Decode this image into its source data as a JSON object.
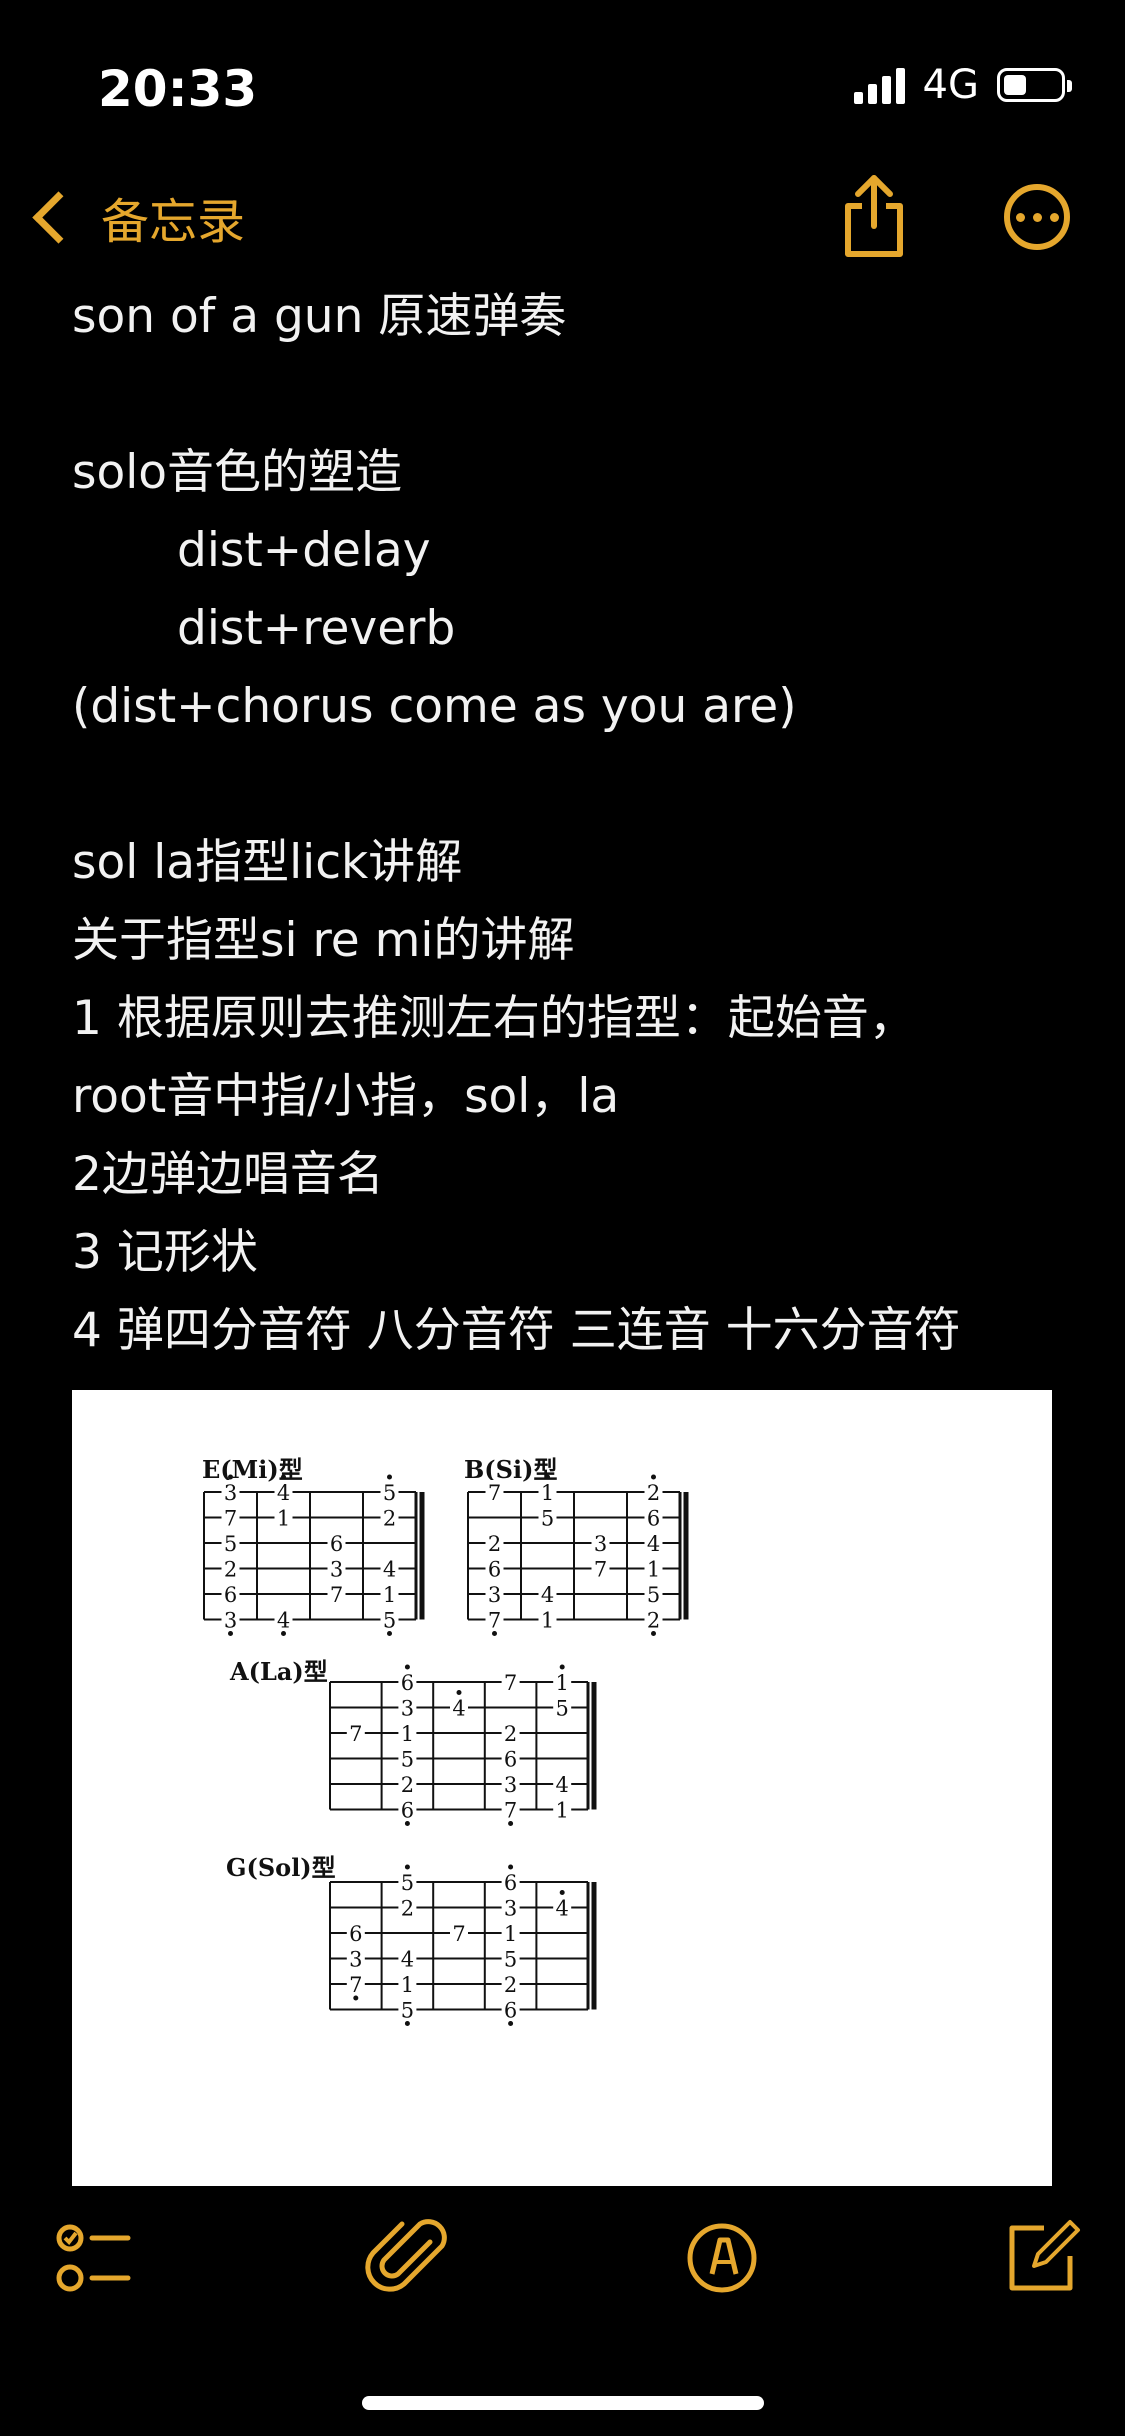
{
  "status": {
    "time": "20:33",
    "network": "4G"
  },
  "nav": {
    "back_label": "备忘录"
  },
  "note": {
    "lines": [
      "son of a gun 原速弹奏",
      "",
      "solo音色的塑造",
      "dist+delay",
      "dist+reverb",
      "(dist+chorus come as you are)",
      "",
      "sol la指型lick讲解",
      "关于指型si re mi的讲解",
      "1 根据原则去推测左右的指型：起始音，",
      "root音中指/小指，sol，la",
      "2边弹边唱音名",
      "3 记形状",
      "4 弹四分音符 八分音符 三连音 十六分音符"
    ]
  },
  "image": {
    "diagrams": [
      {
        "title": "E(Mi)型",
        "notes": [
          {
            "s": 0,
            "f": 0,
            "t": "3",
            "d": "up"
          },
          {
            "s": 1,
            "f": 0,
            "t": "7"
          },
          {
            "s": 2,
            "f": 0,
            "t": "5"
          },
          {
            "s": 3,
            "f": 0,
            "t": "2"
          },
          {
            "s": 4,
            "f": 0,
            "t": "6"
          },
          {
            "s": 5,
            "f": 0,
            "t": "3",
            "d": "down"
          },
          {
            "s": 0,
            "f": 1,
            "t": "4",
            "d": "up"
          },
          {
            "s": 1,
            "f": 1,
            "t": "1"
          },
          {
            "s": 5,
            "f": 1,
            "t": "4",
            "d": "down"
          },
          {
            "s": 2,
            "f": 2,
            "t": "6"
          },
          {
            "s": 3,
            "f": 2,
            "t": "3"
          },
          {
            "s": 4,
            "f": 2,
            "t": "7"
          },
          {
            "s": 0,
            "f": 3,
            "t": "5",
            "d": "up"
          },
          {
            "s": 1,
            "f": 3,
            "t": "2"
          },
          {
            "s": 3,
            "f": 3,
            "t": "4"
          },
          {
            "s": 4,
            "f": 3,
            "t": "1"
          },
          {
            "s": 5,
            "f": 3,
            "t": "5",
            "d": "down"
          }
        ]
      },
      {
        "title": "B(Si)型",
        "notes": [
          {
            "s": 0,
            "f": 0,
            "t": "7"
          },
          {
            "s": 2,
            "f": 0,
            "t": "2"
          },
          {
            "s": 3,
            "f": 0,
            "t": "6"
          },
          {
            "s": 4,
            "f": 0,
            "t": "3"
          },
          {
            "s": 5,
            "f": 0,
            "t": "7",
            "d": "down"
          },
          {
            "s": 0,
            "f": 1,
            "t": "1",
            "d": "up"
          },
          {
            "s": 1,
            "f": 1,
            "t": "5"
          },
          {
            "s": 4,
            "f": 1,
            "t": "4"
          },
          {
            "s": 5,
            "f": 1,
            "t": "1"
          },
          {
            "s": 2,
            "f": 2,
            "t": "3"
          },
          {
            "s": 3,
            "f": 2,
            "t": "7"
          },
          {
            "s": 0,
            "f": 3,
            "t": "2",
            "d": "up"
          },
          {
            "s": 1,
            "f": 3,
            "t": "6"
          },
          {
            "s": 2,
            "f": 3,
            "t": "4"
          },
          {
            "s": 3,
            "f": 3,
            "t": "1"
          },
          {
            "s": 4,
            "f": 3,
            "t": "5"
          },
          {
            "s": 5,
            "f": 3,
            "t": "2",
            "d": "down"
          }
        ]
      },
      {
        "title": "A(La)型",
        "notes": [
          {
            "s": 0,
            "f": 1,
            "t": "6",
            "d": "up"
          },
          {
            "s": 1,
            "f": 1,
            "t": "3"
          },
          {
            "s": 2,
            "f": 1,
            "t": "1"
          },
          {
            "s": 3,
            "f": 1,
            "t": "5"
          },
          {
            "s": 4,
            "f": 1,
            "t": "2"
          },
          {
            "s": 5,
            "f": 1,
            "t": "6",
            "d": "down"
          },
          {
            "s": 2,
            "f": 0,
            "t": "7"
          },
          {
            "s": 1,
            "f": 2,
            "t": "4",
            "d": "up"
          },
          {
            "s": 0,
            "f": 3,
            "t": "7"
          },
          {
            "s": 2,
            "f": 3,
            "t": "2"
          },
          {
            "s": 3,
            "f": 3,
            "t": "6"
          },
          {
            "s": 4,
            "f": 3,
            "t": "3"
          },
          {
            "s": 5,
            "f": 3,
            "t": "7",
            "d": "down"
          },
          {
            "s": 0,
            "f": 4,
            "t": "1",
            "d": "up"
          },
          {
            "s": 1,
            "f": 4,
            "t": "5"
          },
          {
            "s": 4,
            "f": 4,
            "t": "4"
          },
          {
            "s": 5,
            "f": 4,
            "t": "1"
          }
        ]
      },
      {
        "title": "G(Sol)型",
        "notes": [
          {
            "s": 0,
            "f": 1,
            "t": "5",
            "d": "up"
          },
          {
            "s": 1,
            "f": 1,
            "t": "2"
          },
          {
            "s": 3,
            "f": 1,
            "t": "4"
          },
          {
            "s": 4,
            "f": 1,
            "t": "1"
          },
          {
            "s": 5,
            "f": 1,
            "t": "5",
            "d": "down"
          },
          {
            "s": 2,
            "f": 0,
            "t": "6"
          },
          {
            "s": 3,
            "f": 0,
            "t": "3"
          },
          {
            "s": 4,
            "f": 0,
            "t": "7",
            "d": "down"
          },
          {
            "s": 2,
            "f": 2,
            "t": "7"
          },
          {
            "s": 0,
            "f": 3,
            "t": "6",
            "d": "up"
          },
          {
            "s": 1,
            "f": 3,
            "t": "3"
          },
          {
            "s": 2,
            "f": 3,
            "t": "1"
          },
          {
            "s": 3,
            "f": 3,
            "t": "5"
          },
          {
            "s": 4,
            "f": 3,
            "t": "2"
          },
          {
            "s": 5,
            "f": 3,
            "t": "6",
            "d": "down"
          },
          {
            "s": 1,
            "f": 4,
            "t": "4",
            "d": "up"
          }
        ]
      }
    ]
  },
  "colors": {
    "accent": "#e5a72d",
    "background": "#000000",
    "text": "#f2f2f2"
  },
  "toolbar": {
    "icons": [
      "checklist-icon",
      "attachment-icon",
      "markup-icon",
      "compose-icon"
    ]
  }
}
